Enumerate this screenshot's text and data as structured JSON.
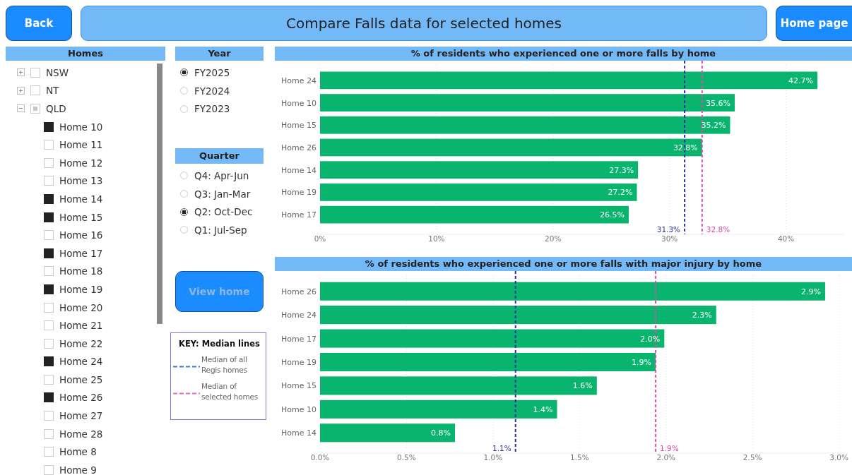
{
  "header": {
    "back": "Back",
    "title": "Compare Falls data for selected homes",
    "home_page": "Home page"
  },
  "homes_filter": {
    "title": "Homes",
    "items": [
      {
        "label": "NSW",
        "expanded": false,
        "checked": false,
        "partial": false
      },
      {
        "label": "NT",
        "expanded": false,
        "checked": false,
        "partial": false
      },
      {
        "label": "QLD",
        "expanded": true,
        "checked": false,
        "partial": true,
        "children": [
          {
            "label": "Home 10",
            "checked": true
          },
          {
            "label": "Home 11",
            "checked": false
          },
          {
            "label": "Home 12",
            "checked": false
          },
          {
            "label": "Home 13",
            "checked": false
          },
          {
            "label": "Home 14",
            "checked": true
          },
          {
            "label": "Home 15",
            "checked": true
          },
          {
            "label": "Home 16",
            "checked": false
          },
          {
            "label": "Home 17",
            "checked": true
          },
          {
            "label": "Home 18",
            "checked": false
          },
          {
            "label": "Home 19",
            "checked": true
          },
          {
            "label": "Home 20",
            "checked": false
          },
          {
            "label": "Home 21",
            "checked": false
          },
          {
            "label": "Home 22",
            "checked": false
          },
          {
            "label": "Home 24",
            "checked": true
          },
          {
            "label": "Home 25",
            "checked": false
          },
          {
            "label": "Home 26",
            "checked": true
          },
          {
            "label": "Home 27",
            "checked": false
          },
          {
            "label": "Home 28",
            "checked": false
          },
          {
            "label": "Home 8",
            "checked": false
          },
          {
            "label": "Home 9",
            "checked": false
          }
        ]
      }
    ]
  },
  "year_filter": {
    "title": "Year",
    "options": [
      {
        "label": "FY2025",
        "selected": true
      },
      {
        "label": "FY2024",
        "selected": false
      },
      {
        "label": "FY2023",
        "selected": false
      }
    ]
  },
  "quarter_filter": {
    "title": "Quarter",
    "options": [
      {
        "label": "Q4: Apr-Jun",
        "selected": false
      },
      {
        "label": "Q3: Jan-Mar",
        "selected": false
      },
      {
        "label": "Q2: Oct-Dec",
        "selected": true
      },
      {
        "label": "Q1: Jul-Sep",
        "selected": false
      }
    ]
  },
  "view_home_button": {
    "label": "View home",
    "disabled": true
  },
  "key": {
    "title": "KEY: Median lines",
    "entries": [
      {
        "label": "Median of all Regis homes",
        "color": "#3a7bd5"
      },
      {
        "label": "Median of selected homes",
        "color": "#e86bc0"
      }
    ]
  },
  "charts": [
    {
      "title": "% of residents who experienced one or more falls by home",
      "chart_data": {
        "type": "bar",
        "orientation": "horizontal",
        "categories": [
          "Home 24",
          "Home 10",
          "Home 15",
          "Home 26",
          "Home 14",
          "Home 19",
          "Home 17"
        ],
        "values": [
          42.7,
          35.6,
          35.2,
          32.8,
          27.3,
          27.2,
          26.5
        ],
        "value_labels": [
          "42.7%",
          "35.6%",
          "35.2%",
          "32.8%",
          "27.3%",
          "27.2%",
          "26.5%"
        ],
        "grid": true,
        "xlim": [
          0,
          45
        ],
        "xticks": [
          {
            "value": 0,
            "label": "0%"
          },
          {
            "value": 10,
            "label": "10%"
          },
          {
            "value": 20,
            "label": "20%"
          },
          {
            "value": 30,
            "label": "30%"
          },
          {
            "value": 40,
            "label": "40%"
          }
        ],
        "ref_lines": [
          {
            "axis": "x",
            "value": 31.3,
            "label": "31.3%",
            "color": "#2a2fa0"
          },
          {
            "axis": "x",
            "value": 32.8,
            "label": "32.8%",
            "color": "#e04aa8"
          }
        ]
      }
    },
    {
      "title": "% of residents who experienced one or more falls with major injury by home",
      "chart_data": {
        "type": "bar",
        "orientation": "horizontal",
        "categories": [
          "Home 26",
          "Home 24",
          "Home 17",
          "Home 19",
          "Home 15",
          "Home 10",
          "Home 14"
        ],
        "values": [
          2.92,
          2.29,
          1.99,
          1.94,
          1.6,
          1.37,
          0.78
        ],
        "value_labels": [
          "2.9%",
          "2.3%",
          "2.0%",
          "1.9%",
          "1.6%",
          "1.4%",
          "0.8%"
        ],
        "grid": true,
        "xlim": [
          0,
          3.03
        ],
        "xticks": [
          {
            "value": 0,
            "label": "0.0%"
          },
          {
            "value": 0.5,
            "label": "0.5%"
          },
          {
            "value": 1,
            "label": "1.0%"
          },
          {
            "value": 1.5,
            "label": "1.5%"
          },
          {
            "value": 2,
            "label": "2.0%"
          },
          {
            "value": 2.5,
            "label": "2.5%"
          },
          {
            "value": 3,
            "label": "3.0%"
          }
        ],
        "ref_lines": [
          {
            "axis": "x",
            "value": 1.13,
            "label": "1.1%",
            "color": "#2a2fa0"
          },
          {
            "axis": "x",
            "value": 1.94,
            "label": "1.9%",
            "color": "#e04aa8"
          }
        ]
      }
    }
  ]
}
